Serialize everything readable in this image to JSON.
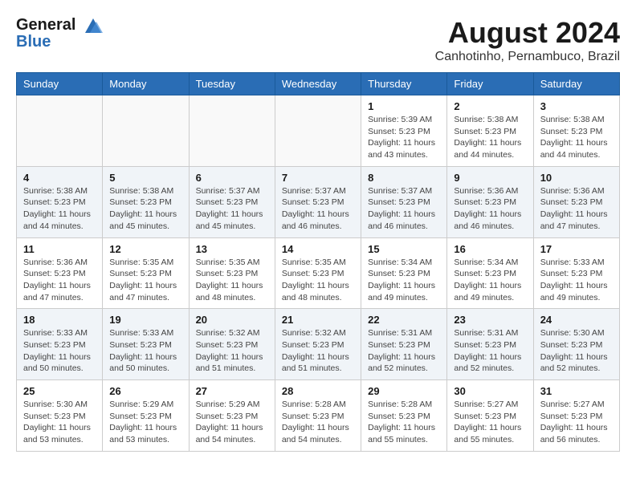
{
  "header": {
    "logo_line1": "General",
    "logo_line2": "Blue",
    "month_title": "August 2024",
    "location": "Canhotinho, Pernambuco, Brazil"
  },
  "weekdays": [
    "Sunday",
    "Monday",
    "Tuesday",
    "Wednesday",
    "Thursday",
    "Friday",
    "Saturday"
  ],
  "weeks": [
    [
      {
        "day": "",
        "info": ""
      },
      {
        "day": "",
        "info": ""
      },
      {
        "day": "",
        "info": ""
      },
      {
        "day": "",
        "info": ""
      },
      {
        "day": "1",
        "info": "Sunrise: 5:39 AM\nSunset: 5:23 PM\nDaylight: 11 hours and 43 minutes."
      },
      {
        "day": "2",
        "info": "Sunrise: 5:38 AM\nSunset: 5:23 PM\nDaylight: 11 hours and 44 minutes."
      },
      {
        "day": "3",
        "info": "Sunrise: 5:38 AM\nSunset: 5:23 PM\nDaylight: 11 hours and 44 minutes."
      }
    ],
    [
      {
        "day": "4",
        "info": "Sunrise: 5:38 AM\nSunset: 5:23 PM\nDaylight: 11 hours and 44 minutes."
      },
      {
        "day": "5",
        "info": "Sunrise: 5:38 AM\nSunset: 5:23 PM\nDaylight: 11 hours and 45 minutes."
      },
      {
        "day": "6",
        "info": "Sunrise: 5:37 AM\nSunset: 5:23 PM\nDaylight: 11 hours and 45 minutes."
      },
      {
        "day": "7",
        "info": "Sunrise: 5:37 AM\nSunset: 5:23 PM\nDaylight: 11 hours and 46 minutes."
      },
      {
        "day": "8",
        "info": "Sunrise: 5:37 AM\nSunset: 5:23 PM\nDaylight: 11 hours and 46 minutes."
      },
      {
        "day": "9",
        "info": "Sunrise: 5:36 AM\nSunset: 5:23 PM\nDaylight: 11 hours and 46 minutes."
      },
      {
        "day": "10",
        "info": "Sunrise: 5:36 AM\nSunset: 5:23 PM\nDaylight: 11 hours and 47 minutes."
      }
    ],
    [
      {
        "day": "11",
        "info": "Sunrise: 5:36 AM\nSunset: 5:23 PM\nDaylight: 11 hours and 47 minutes."
      },
      {
        "day": "12",
        "info": "Sunrise: 5:35 AM\nSunset: 5:23 PM\nDaylight: 11 hours and 47 minutes."
      },
      {
        "day": "13",
        "info": "Sunrise: 5:35 AM\nSunset: 5:23 PM\nDaylight: 11 hours and 48 minutes."
      },
      {
        "day": "14",
        "info": "Sunrise: 5:35 AM\nSunset: 5:23 PM\nDaylight: 11 hours and 48 minutes."
      },
      {
        "day": "15",
        "info": "Sunrise: 5:34 AM\nSunset: 5:23 PM\nDaylight: 11 hours and 49 minutes."
      },
      {
        "day": "16",
        "info": "Sunrise: 5:34 AM\nSunset: 5:23 PM\nDaylight: 11 hours and 49 minutes."
      },
      {
        "day": "17",
        "info": "Sunrise: 5:33 AM\nSunset: 5:23 PM\nDaylight: 11 hours and 49 minutes."
      }
    ],
    [
      {
        "day": "18",
        "info": "Sunrise: 5:33 AM\nSunset: 5:23 PM\nDaylight: 11 hours and 50 minutes."
      },
      {
        "day": "19",
        "info": "Sunrise: 5:33 AM\nSunset: 5:23 PM\nDaylight: 11 hours and 50 minutes."
      },
      {
        "day": "20",
        "info": "Sunrise: 5:32 AM\nSunset: 5:23 PM\nDaylight: 11 hours and 51 minutes."
      },
      {
        "day": "21",
        "info": "Sunrise: 5:32 AM\nSunset: 5:23 PM\nDaylight: 11 hours and 51 minutes."
      },
      {
        "day": "22",
        "info": "Sunrise: 5:31 AM\nSunset: 5:23 PM\nDaylight: 11 hours and 52 minutes."
      },
      {
        "day": "23",
        "info": "Sunrise: 5:31 AM\nSunset: 5:23 PM\nDaylight: 11 hours and 52 minutes."
      },
      {
        "day": "24",
        "info": "Sunrise: 5:30 AM\nSunset: 5:23 PM\nDaylight: 11 hours and 52 minutes."
      }
    ],
    [
      {
        "day": "25",
        "info": "Sunrise: 5:30 AM\nSunset: 5:23 PM\nDaylight: 11 hours and 53 minutes."
      },
      {
        "day": "26",
        "info": "Sunrise: 5:29 AM\nSunset: 5:23 PM\nDaylight: 11 hours and 53 minutes."
      },
      {
        "day": "27",
        "info": "Sunrise: 5:29 AM\nSunset: 5:23 PM\nDaylight: 11 hours and 54 minutes."
      },
      {
        "day": "28",
        "info": "Sunrise: 5:28 AM\nSunset: 5:23 PM\nDaylight: 11 hours and 54 minutes."
      },
      {
        "day": "29",
        "info": "Sunrise: 5:28 AM\nSunset: 5:23 PM\nDaylight: 11 hours and 55 minutes."
      },
      {
        "day": "30",
        "info": "Sunrise: 5:27 AM\nSunset: 5:23 PM\nDaylight: 11 hours and 55 minutes."
      },
      {
        "day": "31",
        "info": "Sunrise: 5:27 AM\nSunset: 5:23 PM\nDaylight: 11 hours and 56 minutes."
      }
    ]
  ]
}
